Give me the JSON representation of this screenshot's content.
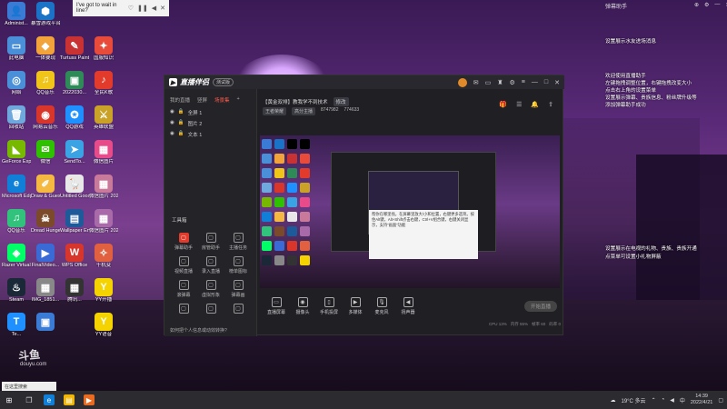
{
  "notification": {
    "text": "I've got to wait in line?"
  },
  "desktop_icons": [
    {
      "label": "Administ...",
      "color": "#3a7bd5",
      "glyph": "👤"
    },
    {
      "label": "暴雪游戏平台",
      "color": "#1a73c7",
      "glyph": "⬢"
    },
    {
      "label": "",
      "color": "#000",
      "glyph": ""
    },
    {
      "label": "",
      "color": "#000",
      "glyph": ""
    },
    {
      "label": "此电脑",
      "color": "#4a90d9",
      "glyph": "▭"
    },
    {
      "label": "一体要现",
      "color": "#f2a33a",
      "glyph": "◆"
    },
    {
      "label": "Turtuss Paint",
      "color": "#c83232",
      "glyph": "✎"
    },
    {
      "label": "国服知识",
      "color": "#e84b3a",
      "glyph": "✦"
    },
    {
      "label": "网络",
      "color": "#4a90d9",
      "glyph": "◎"
    },
    {
      "label": "QQ音乐",
      "color": "#f0c419",
      "glyph": "♫"
    },
    {
      "label": "2022030...",
      "color": "#2e8b57",
      "glyph": "▣"
    },
    {
      "label": "全民K歌",
      "color": "#e23b2b",
      "glyph": "♪"
    },
    {
      "label": "回收站",
      "color": "#6fa8dc",
      "glyph": "🗑"
    },
    {
      "label": "网易云音乐",
      "color": "#d9362b",
      "glyph": "◉"
    },
    {
      "label": "QQ游戏",
      "color": "#1e90ff",
      "glyph": "✪"
    },
    {
      "label": "英雄联盟",
      "color": "#c9a227",
      "glyph": "⚔"
    },
    {
      "label": "GeForce Experience",
      "color": "#76b900",
      "glyph": "◣"
    },
    {
      "label": "微信",
      "color": "#2dc100",
      "glyph": "✉"
    },
    {
      "label": "SendTo...",
      "color": "#3aa3e3",
      "glyph": "➤"
    },
    {
      "label": "微信图片",
      "color": "#e84b8a",
      "glyph": "▦"
    },
    {
      "label": "Microsoft Edge",
      "color": "#0f7fd8",
      "glyph": "e"
    },
    {
      "label": "Draw & Guess",
      "color": "#f5b942",
      "glyph": "✐"
    },
    {
      "label": "Untitled Goose",
      "color": "#e8e8e8",
      "glyph": "🪿"
    },
    {
      "label": "微信图片 2022...",
      "color": "#c97a9a",
      "glyph": "▦"
    },
    {
      "label": "QQ音乐",
      "color": "#31c27c",
      "glyph": "♫"
    },
    {
      "label": "Dread Hunger",
      "color": "#7a4a2a",
      "glyph": "☠"
    },
    {
      "label": "Wallpaper Engine",
      "color": "#1c5a9a",
      "glyph": "▤"
    },
    {
      "label": "微信图片 2022...",
      "color": "#a96aa9",
      "glyph": "▦"
    },
    {
      "label": "Razer Virtual R...",
      "color": "#00ff66",
      "glyph": "◈"
    },
    {
      "label": "FinalVideo...",
      "color": "#3a6ad5",
      "glyph": "▶"
    },
    {
      "label": "WPS Office",
      "color": "#d9362b",
      "glyph": "W"
    },
    {
      "label": "千机变",
      "color": "#e06040",
      "glyph": "✧"
    },
    {
      "label": "Steam",
      "color": "#1b2838",
      "glyph": "♨"
    },
    {
      "label": "IMG_1851...",
      "color": "#888",
      "glyph": "▦"
    },
    {
      "label": "腾讯...",
      "color": "#333",
      "glyph": "▦"
    },
    {
      "label": "YY开播",
      "color": "#f5d300",
      "glyph": "Y"
    },
    {
      "label": "Te...",
      "color": "#1e90ff",
      "glyph": "T"
    },
    {
      "label": "",
      "color": "#3a7bd5",
      "glyph": "▣"
    },
    {
      "label": "",
      "color": "#000",
      "glyph": ""
    },
    {
      "label": "YY语音",
      "color": "#f5d300",
      "glyph": "Y"
    }
  ],
  "window": {
    "app_name": "直播伴侣",
    "version": "测试版",
    "left_tabs": [
      "我的直播",
      "竖屏",
      "场景集"
    ],
    "scenes": [
      "全屏 1",
      "图片 2",
      "文本 1"
    ],
    "tools_title": "工具箱",
    "tools": [
      {
        "label": "弹幕助手",
        "red": true
      },
      {
        "label": "房管助手",
        "red": false
      },
      {
        "label": "主播任务",
        "red": false
      },
      {
        "label": "视频直播",
        "red": false
      },
      {
        "label": "录入直播",
        "red": false
      },
      {
        "label": "榜单图标",
        "red": false
      },
      {
        "label": "滚弹幕",
        "red": false
      },
      {
        "label": "虚拟形象",
        "red": false
      },
      {
        "label": "弹幕画",
        "red": false
      },
      {
        "label": "",
        "red": false
      },
      {
        "label": "",
        "red": false
      },
      {
        "label": "",
        "red": false
      }
    ],
    "hint": "如何把个人信息或动效转换?",
    "room_title": "【黄金双排】教我学不到技术",
    "room_tag": "修改",
    "room_sub_tags": [
      "王者荣耀",
      "高分主播",
      "8747982",
      "774633"
    ],
    "bottom_buttons": [
      "直播屏幕",
      "摄像头",
      "手机投屏",
      "多媒体",
      "麦克风",
      "扬声器"
    ],
    "start_button": "开始直播",
    "stats": [
      "CPU 13%",
      "内存 55%",
      "帧率 60",
      "码率 0"
    ],
    "preview_tip": "帮你在哪里找，在屏幕里放大/小和位置，右键更多选项。按住Alt键，Alt+Shift点击右键，Ctrl+V组合键，右键关闭显示，支持“画面”功能"
  },
  "right_panel": {
    "top": "弹幕助手",
    "lines": [
      {
        "text": "设置展示水友进场消息"
      },
      {
        "text": "欢迎使用直播助手"
      },
      {
        "text": "左键拖拽调整位置，右键拖拽改变大小"
      },
      {
        "text": "点击右上角的设置菜单"
      },
      {
        "text": "设置展示弹幕、贵族信息、粉丝牌升级等"
      },
      {
        "text": "添加弹幕助手成功"
      },
      {
        "text": "设置展示在电视的礼物、贵族、贵族开通"
      },
      {
        "text": "点菜单可设置小礼物屏蔽"
      }
    ]
  },
  "taskbar": {
    "weather": "19°C 多云",
    "time": "14:39",
    "date": "2022/4/21",
    "search_placeholder": "在这里搜索"
  },
  "watermark": {
    "main": "斗鱼",
    "sub": "douyu.com"
  }
}
